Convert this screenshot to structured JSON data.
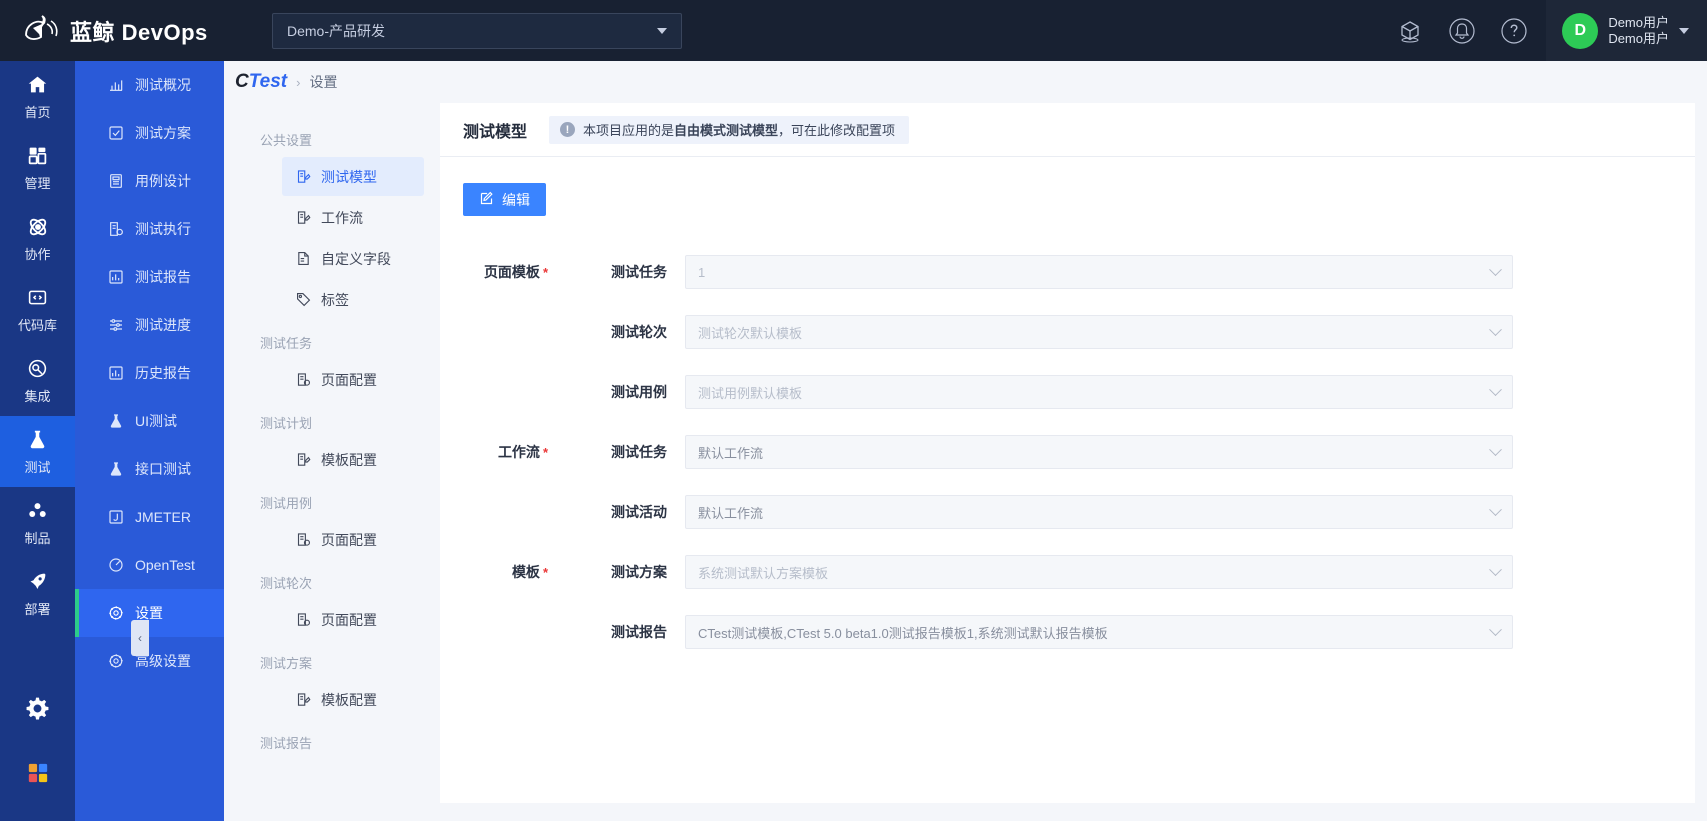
{
  "header": {
    "brand": "蓝鲸 DevOps",
    "brand_logo_icon": "whale-logo-icon",
    "project_selector": {
      "value": "Demo-产品研发",
      "caret_icon": "caret-down-icon"
    },
    "icons": [
      {
        "name": "cube-icon",
        "glyph": "cube"
      },
      {
        "name": "bell-icon",
        "glyph": "bell"
      },
      {
        "name": "help-icon",
        "glyph": "question-circle"
      }
    ],
    "user": {
      "avatar_letter": "D",
      "name_line1": "Demo用户",
      "name_line2": "Demo用户",
      "avatar_color": "#2dcb56"
    }
  },
  "rail": {
    "items": [
      {
        "label": "首页",
        "icon": "home-icon",
        "active": false
      },
      {
        "label": "管理",
        "icon": "dashboard-icon",
        "active": false
      },
      {
        "label": "协作",
        "icon": "atom-icon",
        "active": false
      },
      {
        "label": "代码库",
        "icon": "code-icon",
        "active": false
      },
      {
        "label": "集成",
        "icon": "integration-icon",
        "active": false
      },
      {
        "label": "测试",
        "icon": "flask-icon",
        "active": true
      },
      {
        "label": "制品",
        "icon": "package-icon",
        "active": false
      },
      {
        "label": "部署",
        "icon": "rocket-icon",
        "active": false
      }
    ],
    "bottom_icons": [
      {
        "name": "gear-icon"
      },
      {
        "name": "apps-grid-icon"
      }
    ]
  },
  "subnav": {
    "items": [
      {
        "label": "测试概况",
        "icon": "chart-icon",
        "active": false
      },
      {
        "label": "测试方案",
        "icon": "checkbox-icon",
        "active": false
      },
      {
        "label": "用例设计",
        "icon": "document-icon",
        "active": false
      },
      {
        "label": "测试执行",
        "icon": "execute-icon",
        "active": false
      },
      {
        "label": "测试报告",
        "icon": "report-icon",
        "active": false
      },
      {
        "label": "测试进度",
        "icon": "progress-icon",
        "active": false
      },
      {
        "label": "历史报告",
        "icon": "history-report-icon",
        "active": false
      },
      {
        "label": "UI测试",
        "icon": "flask-icon",
        "active": false
      },
      {
        "label": "接口测试",
        "icon": "flask-icon",
        "active": false
      },
      {
        "label": "JMETER",
        "icon": "jmeter-icon",
        "active": false
      },
      {
        "label": "OpenTest",
        "icon": "speedometer-icon",
        "active": false
      },
      {
        "label": "设置",
        "icon": "gear-icon",
        "active": true
      },
      {
        "label": "高级设置",
        "icon": "gear-icon",
        "active": false
      }
    ],
    "collapse_icon": "chevron-left-icon"
  },
  "breadcrumb": {
    "app_prefix": "C",
    "app_suffix": "Test",
    "separator": "›",
    "current": "设置"
  },
  "settings_nav": {
    "groups": [
      {
        "title": "公共设置",
        "items": [
          {
            "label": "测试模型",
            "icon": "model-icon",
            "active": true
          },
          {
            "label": "工作流",
            "icon": "workflow-icon",
            "active": false
          },
          {
            "label": "自定义字段",
            "icon": "field-icon",
            "active": false
          },
          {
            "label": "标签",
            "icon": "tag-icon",
            "active": false
          }
        ]
      },
      {
        "title": "测试任务",
        "items": [
          {
            "label": "页面配置",
            "icon": "page-config-icon",
            "active": false
          }
        ]
      },
      {
        "title": "测试计划",
        "items": [
          {
            "label": "模板配置",
            "icon": "template-config-icon",
            "active": false
          }
        ]
      },
      {
        "title": "测试用例",
        "items": [
          {
            "label": "页面配置",
            "icon": "page-config-icon",
            "active": false
          }
        ]
      },
      {
        "title": "测试轮次",
        "items": [
          {
            "label": "页面配置",
            "icon": "page-config-icon",
            "active": false
          }
        ]
      },
      {
        "title": "测试方案",
        "items": [
          {
            "label": "模板配置",
            "icon": "template-config-icon",
            "active": false
          }
        ]
      },
      {
        "title": "测试报告",
        "items": []
      }
    ]
  },
  "panel": {
    "title": "测试模型",
    "banner": {
      "icon": "info-icon",
      "text_before": "本项目应用的是",
      "text_strong": "自由模式测试模型",
      "text_after": "，可在此修改配置项"
    },
    "edit_button": {
      "label": "编辑",
      "icon": "edit-pencil-icon",
      "color": "#3a84ff"
    },
    "form": {
      "rows": [
        {
          "group": "页面模板",
          "required": true,
          "sub": "测试任务",
          "value": "1",
          "chevron": "chevron-down-icon"
        },
        {
          "group": "",
          "required": false,
          "sub": "测试轮次",
          "value": "测试轮次默认模板",
          "chevron": "chevron-down-icon"
        },
        {
          "group": "",
          "required": false,
          "sub": "测试用例",
          "value": "测试用例默认模板",
          "chevron": "chevron-down-icon"
        },
        {
          "group": "工作流",
          "required": true,
          "sub": "测试任务",
          "value": "默认工作流",
          "chevron": "chevron-down-icon"
        },
        {
          "group": "",
          "required": false,
          "sub": "测试活动",
          "value": "默认工作流",
          "chevron": "chevron-down-icon"
        },
        {
          "group": "模板",
          "required": true,
          "sub": "测试方案",
          "value": "系统测试默认方案模板",
          "chevron": "chevron-down-icon"
        },
        {
          "group": "",
          "required": false,
          "sub": "测试报告",
          "value": "CTest测试模板,CTest 5.0 beta1.0测试报告模板1,系统测试默认报告模板",
          "chevron": "chevron-down-icon"
        }
      ]
    }
  }
}
